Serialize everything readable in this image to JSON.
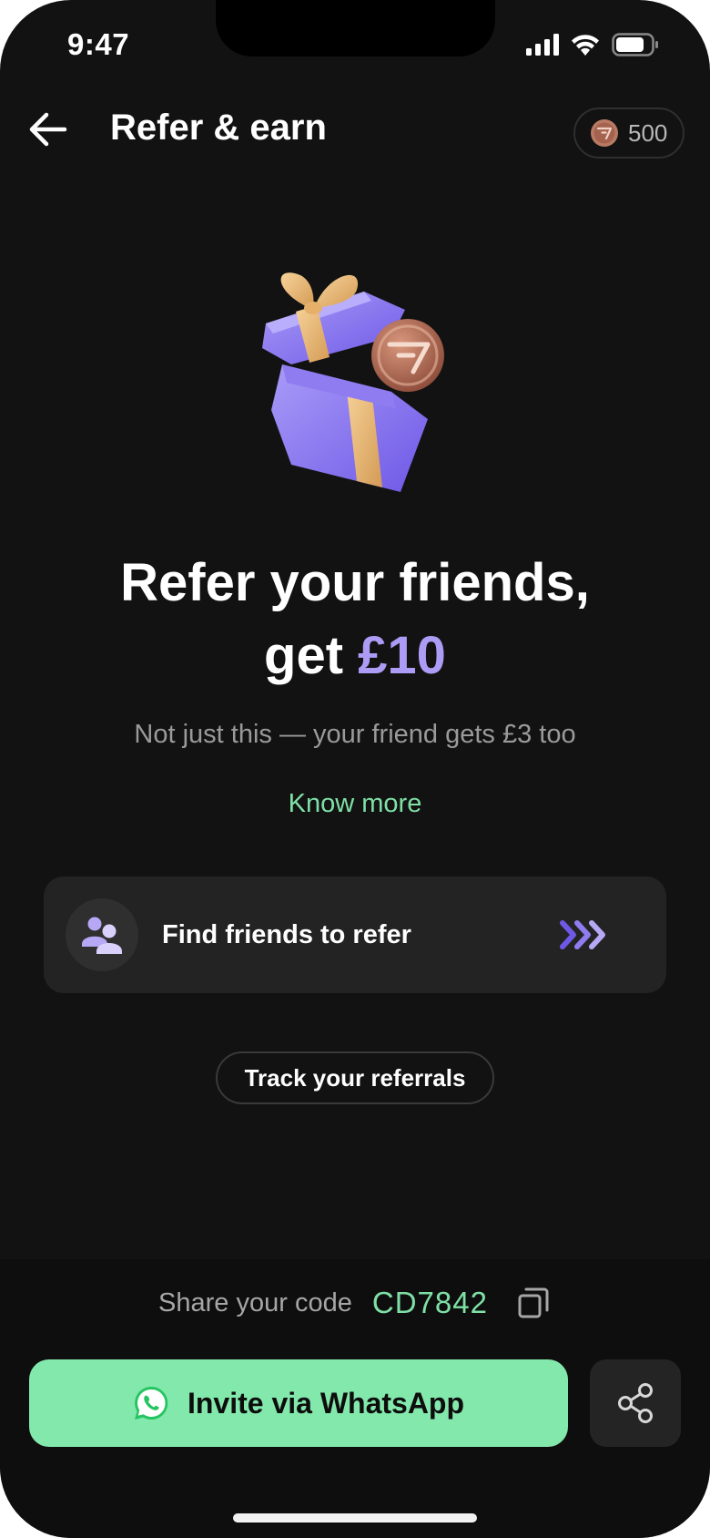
{
  "status_bar": {
    "time": "9:47"
  },
  "header": {
    "title": "Refer & earn",
    "coin_balance": "500"
  },
  "hero": {
    "headline_line1": "Refer your friends,",
    "headline_get": "get",
    "headline_amount": "£10",
    "subtext": "Not just this — your friend gets £3 too",
    "know_more": "Know more"
  },
  "find_friends": {
    "label": "Find friends to refer"
  },
  "track": {
    "label": "Track your referrals"
  },
  "share": {
    "label": "Share your code",
    "code": "CD7842"
  },
  "actions": {
    "whatsapp_label": "Invite via WhatsApp"
  },
  "colors": {
    "background": "#121212",
    "accent_purple": "#ad9cf6",
    "accent_green": "#83e8ab",
    "card": "#232323"
  },
  "icons": {
    "back": "arrow-left-icon",
    "coin": "coin-icon",
    "people": "people-icon",
    "arrows": "triple-chevron-right-icon",
    "copy": "copy-icon",
    "whatsapp": "whatsapp-icon",
    "share": "share-icon"
  }
}
